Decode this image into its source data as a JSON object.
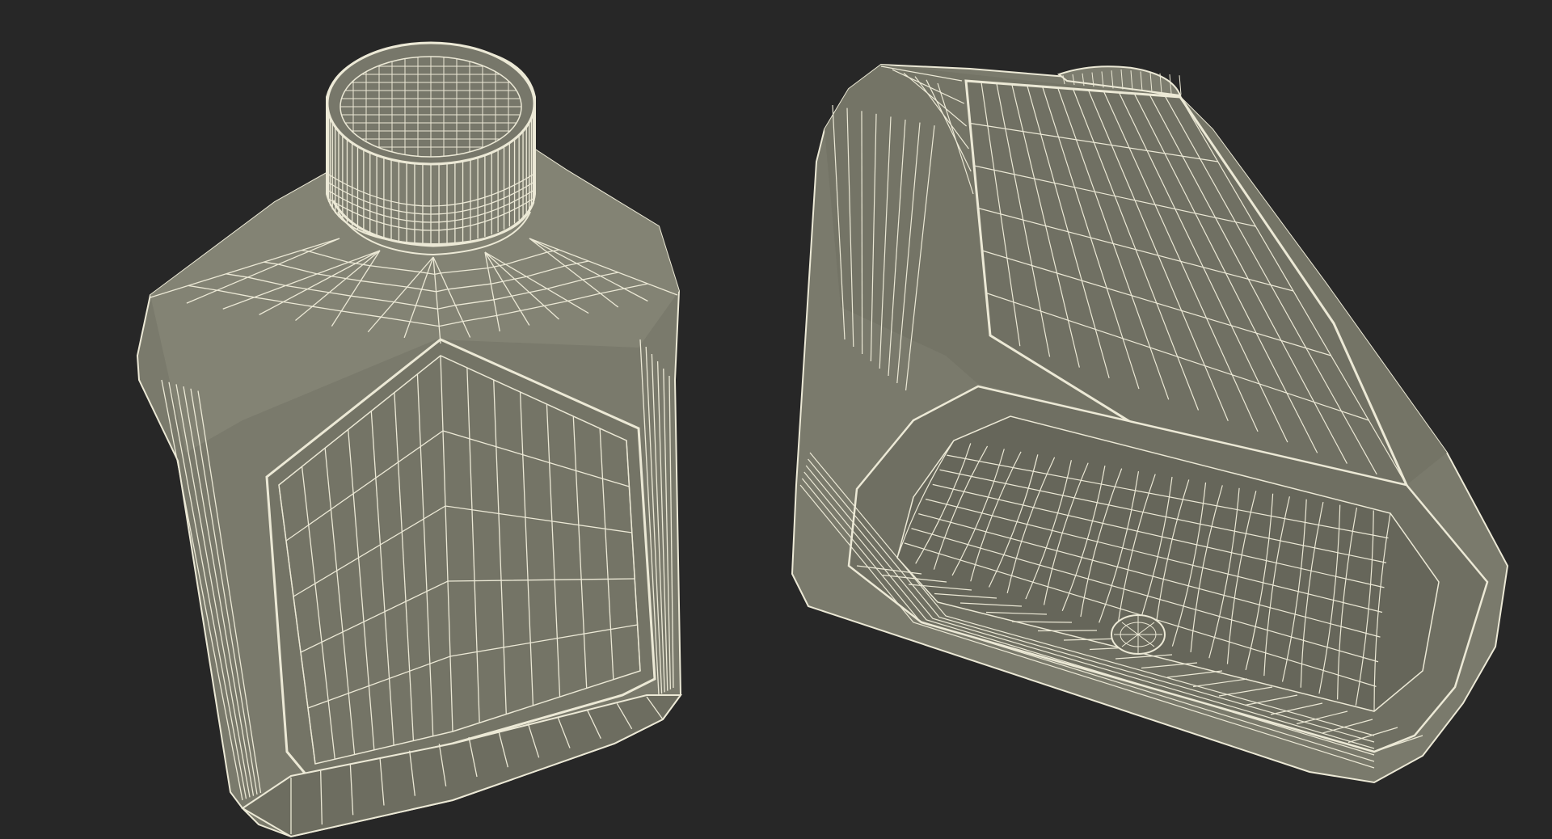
{
  "scene": {
    "background_color": "#272727",
    "model_fill_color": "#7a7a6c",
    "model_shadow_color": "#5f5f54",
    "wire_color": "#ece9d6",
    "objects": [
      {
        "name": "bottle-front-view",
        "render_style": "wireframe"
      },
      {
        "name": "bottle-bottom-view",
        "render_style": "wireframe"
      }
    ]
  }
}
